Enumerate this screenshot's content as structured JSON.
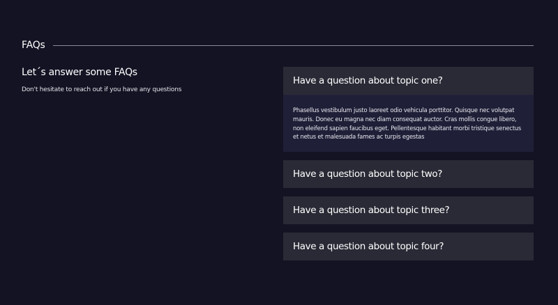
{
  "section": {
    "title": "FAQs"
  },
  "intro": {
    "heading": "Let´s answer some FAQs",
    "subtext": "Don't hesitate to reach out if you have any questions"
  },
  "faqs": [
    {
      "question": "Have a question about topic one?",
      "answer": "Phasellus vestibulum justo laoreet odio vehicula porttitor. Quisque nec volutpat mauris. Donec eu magna nec diam consequat auctor. Cras mollis congue libero, non eleifend sapien faucibus eget. Pellentesque habitant morbi tristique senectus et netus et malesuada fames ac turpis egestas",
      "expanded": true
    },
    {
      "question": "Have a question about topic two?",
      "expanded": false
    },
    {
      "question": "Have a question about topic three?",
      "expanded": false
    },
    {
      "question": "Have a question about topic four?",
      "expanded": false
    }
  ],
  "colors": {
    "background": "#131324",
    "question_bg": "#2a2a36",
    "answer_bg": "#1f1f38",
    "rule": "#8a8a98"
  }
}
